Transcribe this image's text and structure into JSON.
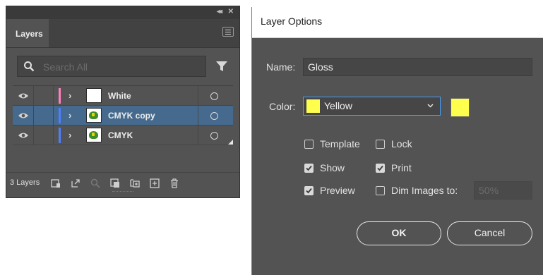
{
  "layers_panel": {
    "topbar": {
      "collapse_icon": "double-chevron-left",
      "close_icon": "x"
    },
    "tab_label": "Layers",
    "search": {
      "placeholder": "Search All",
      "value": ""
    },
    "layers": [
      {
        "name": "White",
        "color": "#ff7fc1",
        "visible": true,
        "selected": false,
        "thumbnail": "blank"
      },
      {
        "name": "CMYK copy",
        "color": "#4f7fff",
        "visible": true,
        "selected": true,
        "thumbnail": "badge"
      },
      {
        "name": "CMYK",
        "color": "#4f7fff",
        "visible": true,
        "selected": false,
        "thumbnail": "badge"
      }
    ],
    "footer": {
      "layer_count": "3 Layers",
      "icons": [
        "collect-for-export-icon",
        "export-icon",
        "locate-object-icon",
        "make-clipping-mask-icon",
        "create-sublayer-icon",
        "create-layer-icon",
        "trash-icon"
      ]
    }
  },
  "dialog": {
    "title": "Layer Options",
    "name_label": "Name:",
    "name_value": "Gloss",
    "color_label": "Color:",
    "color_value": "Yellow",
    "color_hex": "#ffff4d",
    "options": {
      "template": {
        "label": "Template",
        "checked": false
      },
      "lock": {
        "label": "Lock",
        "checked": false
      },
      "show": {
        "label": "Show",
        "checked": true
      },
      "print": {
        "label": "Print",
        "checked": true
      },
      "preview": {
        "label": "Preview",
        "checked": true
      },
      "dim_images": {
        "label": "Dim Images to:",
        "checked": false,
        "value": "50%"
      }
    },
    "ok_label": "OK",
    "cancel_label": "Cancel"
  }
}
